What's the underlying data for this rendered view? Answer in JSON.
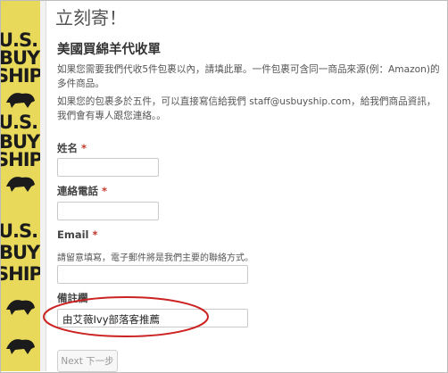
{
  "page": {
    "heading": "立刻寄！",
    "form_title": "美國買綿羊代收單",
    "description_1": "如果您需要我們代收5件包裹以內，請填此單。一件包裹可含同一商品來源(例：Amazon)的多件商品。",
    "description_2": "如果您的包裹多於五件，可以直接寫信給我們 staff@usbuyship.com，給我們商品資訊，我們會有專人跟您連絡。。"
  },
  "side_strip": {
    "lines": [
      "U.S.",
      "BUY",
      "SHIP",
      "U.S.",
      "BUY",
      "SHIP",
      "U.S.",
      "BUY",
      "SHIP"
    ]
  },
  "form": {
    "name_label": "姓名",
    "phone_label": "連絡電話",
    "email_label": "Email",
    "email_hint": "請留意填寫，電子郵件將是我們主要的聯絡方式。",
    "note_label": "備註欄",
    "note_value": "由艾薇Ivy部落客推薦",
    "required_mark": "*",
    "next_button": "Next 下一步"
  },
  "colors": {
    "strip": "#e8d95a",
    "annotation": "#cc2222",
    "required": "#c0392b"
  }
}
